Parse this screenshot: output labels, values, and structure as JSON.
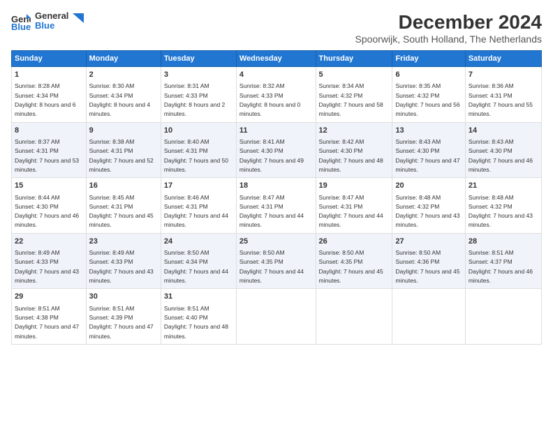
{
  "logo": {
    "line1": "General",
    "line2": "Blue"
  },
  "title": "December 2024",
  "subtitle": "Spoorwijk, South Holland, The Netherlands",
  "weekdays": [
    "Sunday",
    "Monday",
    "Tuesday",
    "Wednesday",
    "Thursday",
    "Friday",
    "Saturday"
  ],
  "weeks": [
    [
      {
        "day": "1",
        "sunrise": "Sunrise: 8:28 AM",
        "sunset": "Sunset: 4:34 PM",
        "daylight": "Daylight: 8 hours and 6 minutes."
      },
      {
        "day": "2",
        "sunrise": "Sunrise: 8:30 AM",
        "sunset": "Sunset: 4:34 PM",
        "daylight": "Daylight: 8 hours and 4 minutes."
      },
      {
        "day": "3",
        "sunrise": "Sunrise: 8:31 AM",
        "sunset": "Sunset: 4:33 PM",
        "daylight": "Daylight: 8 hours and 2 minutes."
      },
      {
        "day": "4",
        "sunrise": "Sunrise: 8:32 AM",
        "sunset": "Sunset: 4:33 PM",
        "daylight": "Daylight: 8 hours and 0 minutes."
      },
      {
        "day": "5",
        "sunrise": "Sunrise: 8:34 AM",
        "sunset": "Sunset: 4:32 PM",
        "daylight": "Daylight: 7 hours and 58 minutes."
      },
      {
        "day": "6",
        "sunrise": "Sunrise: 8:35 AM",
        "sunset": "Sunset: 4:32 PM",
        "daylight": "Daylight: 7 hours and 56 minutes."
      },
      {
        "day": "7",
        "sunrise": "Sunrise: 8:36 AM",
        "sunset": "Sunset: 4:31 PM",
        "daylight": "Daylight: 7 hours and 55 minutes."
      }
    ],
    [
      {
        "day": "8",
        "sunrise": "Sunrise: 8:37 AM",
        "sunset": "Sunset: 4:31 PM",
        "daylight": "Daylight: 7 hours and 53 minutes."
      },
      {
        "day": "9",
        "sunrise": "Sunrise: 8:38 AM",
        "sunset": "Sunset: 4:31 PM",
        "daylight": "Daylight: 7 hours and 52 minutes."
      },
      {
        "day": "10",
        "sunrise": "Sunrise: 8:40 AM",
        "sunset": "Sunset: 4:31 PM",
        "daylight": "Daylight: 7 hours and 50 minutes."
      },
      {
        "day": "11",
        "sunrise": "Sunrise: 8:41 AM",
        "sunset": "Sunset: 4:30 PM",
        "daylight": "Daylight: 7 hours and 49 minutes."
      },
      {
        "day": "12",
        "sunrise": "Sunrise: 8:42 AM",
        "sunset": "Sunset: 4:30 PM",
        "daylight": "Daylight: 7 hours and 48 minutes."
      },
      {
        "day": "13",
        "sunrise": "Sunrise: 8:43 AM",
        "sunset": "Sunset: 4:30 PM",
        "daylight": "Daylight: 7 hours and 47 minutes."
      },
      {
        "day": "14",
        "sunrise": "Sunrise: 8:43 AM",
        "sunset": "Sunset: 4:30 PM",
        "daylight": "Daylight: 7 hours and 46 minutes."
      }
    ],
    [
      {
        "day": "15",
        "sunrise": "Sunrise: 8:44 AM",
        "sunset": "Sunset: 4:30 PM",
        "daylight": "Daylight: 7 hours and 46 minutes."
      },
      {
        "day": "16",
        "sunrise": "Sunrise: 8:45 AM",
        "sunset": "Sunset: 4:31 PM",
        "daylight": "Daylight: 7 hours and 45 minutes."
      },
      {
        "day": "17",
        "sunrise": "Sunrise: 8:46 AM",
        "sunset": "Sunset: 4:31 PM",
        "daylight": "Daylight: 7 hours and 44 minutes."
      },
      {
        "day": "18",
        "sunrise": "Sunrise: 8:47 AM",
        "sunset": "Sunset: 4:31 PM",
        "daylight": "Daylight: 7 hours and 44 minutes."
      },
      {
        "day": "19",
        "sunrise": "Sunrise: 8:47 AM",
        "sunset": "Sunset: 4:31 PM",
        "daylight": "Daylight: 7 hours and 44 minutes."
      },
      {
        "day": "20",
        "sunrise": "Sunrise: 8:48 AM",
        "sunset": "Sunset: 4:32 PM",
        "daylight": "Daylight: 7 hours and 43 minutes."
      },
      {
        "day": "21",
        "sunrise": "Sunrise: 8:48 AM",
        "sunset": "Sunset: 4:32 PM",
        "daylight": "Daylight: 7 hours and 43 minutes."
      }
    ],
    [
      {
        "day": "22",
        "sunrise": "Sunrise: 8:49 AM",
        "sunset": "Sunset: 4:33 PM",
        "daylight": "Daylight: 7 hours and 43 minutes."
      },
      {
        "day": "23",
        "sunrise": "Sunrise: 8:49 AM",
        "sunset": "Sunset: 4:33 PM",
        "daylight": "Daylight: 7 hours and 43 minutes."
      },
      {
        "day": "24",
        "sunrise": "Sunrise: 8:50 AM",
        "sunset": "Sunset: 4:34 PM",
        "daylight": "Daylight: 7 hours and 44 minutes."
      },
      {
        "day": "25",
        "sunrise": "Sunrise: 8:50 AM",
        "sunset": "Sunset: 4:35 PM",
        "daylight": "Daylight: 7 hours and 44 minutes."
      },
      {
        "day": "26",
        "sunrise": "Sunrise: 8:50 AM",
        "sunset": "Sunset: 4:35 PM",
        "daylight": "Daylight: 7 hours and 45 minutes."
      },
      {
        "day": "27",
        "sunrise": "Sunrise: 8:50 AM",
        "sunset": "Sunset: 4:36 PM",
        "daylight": "Daylight: 7 hours and 45 minutes."
      },
      {
        "day": "28",
        "sunrise": "Sunrise: 8:51 AM",
        "sunset": "Sunset: 4:37 PM",
        "daylight": "Daylight: 7 hours and 46 minutes."
      }
    ],
    [
      {
        "day": "29",
        "sunrise": "Sunrise: 8:51 AM",
        "sunset": "Sunset: 4:38 PM",
        "daylight": "Daylight: 7 hours and 47 minutes."
      },
      {
        "day": "30",
        "sunrise": "Sunrise: 8:51 AM",
        "sunset": "Sunset: 4:39 PM",
        "daylight": "Daylight: 7 hours and 47 minutes."
      },
      {
        "day": "31",
        "sunrise": "Sunrise: 8:51 AM",
        "sunset": "Sunset: 4:40 PM",
        "daylight": "Daylight: 7 hours and 48 minutes."
      },
      null,
      null,
      null,
      null
    ]
  ]
}
